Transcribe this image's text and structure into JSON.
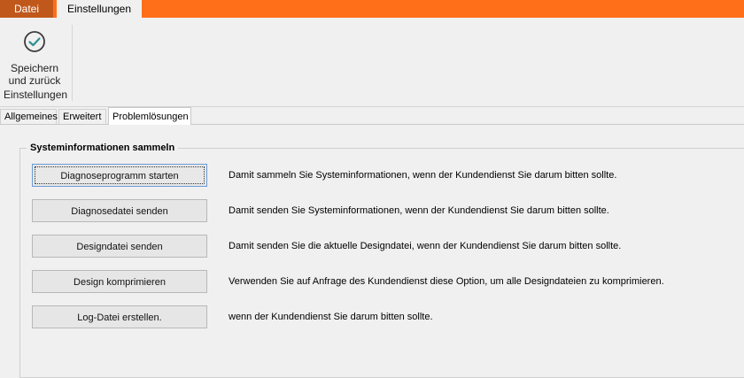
{
  "menu": {
    "file_label": "Datei",
    "settings_label": "Einstellungen"
  },
  "ribbon": {
    "save_button_label": "Speichern\nund zurück",
    "group_label": "Einstellungen",
    "icon": "check-circle-icon"
  },
  "tabs": [
    {
      "label": "Allgemeines"
    },
    {
      "label": "Erweitert"
    },
    {
      "label": "Problemlösungen"
    }
  ],
  "section": {
    "title": "Systeminformationen sammeln",
    "rows": [
      {
        "button": "Diagnoseprogramm starten",
        "description": "Damit sammeln Sie Systeminformationen, wenn der Kundendienst Sie darum bitten sollte."
      },
      {
        "button": "Diagnosedatei senden",
        "description": "Damit senden Sie Systeminformationen, wenn der Kundendienst Sie darum bitten sollte."
      },
      {
        "button": "Designdatei senden",
        "description": "Damit senden Sie die aktuelle Designdatei, wenn der Kundendienst Sie darum bitten sollte."
      },
      {
        "button": "Design komprimieren",
        "description": "Verwenden Sie auf Anfrage des Kundendienst diese Option, um alle Designdateien zu komprimieren."
      },
      {
        "button": "Log-Datei erstellen.",
        "description": "wenn der Kundendienst Sie darum bitten sollte."
      }
    ]
  },
  "colors": {
    "accent": "#ff6f1a",
    "file_tab": "#c0581c",
    "icon_teal": "#2e8f8f"
  }
}
